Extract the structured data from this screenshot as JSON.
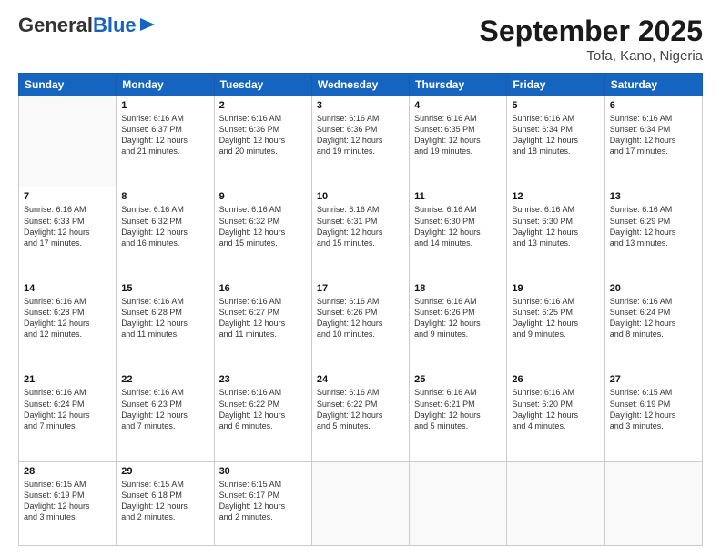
{
  "header": {
    "logo": {
      "general": "General",
      "blue": "Blue"
    },
    "title": "September 2025",
    "location": "Tofa, Kano, Nigeria"
  },
  "days_of_week": [
    "Sunday",
    "Monday",
    "Tuesday",
    "Wednesday",
    "Thursday",
    "Friday",
    "Saturday"
  ],
  "weeks": [
    [
      {
        "day": "",
        "info": ""
      },
      {
        "day": "1",
        "info": "Sunrise: 6:16 AM\nSunset: 6:37 PM\nDaylight: 12 hours\nand 21 minutes."
      },
      {
        "day": "2",
        "info": "Sunrise: 6:16 AM\nSunset: 6:36 PM\nDaylight: 12 hours\nand 20 minutes."
      },
      {
        "day": "3",
        "info": "Sunrise: 6:16 AM\nSunset: 6:36 PM\nDaylight: 12 hours\nand 19 minutes."
      },
      {
        "day": "4",
        "info": "Sunrise: 6:16 AM\nSunset: 6:35 PM\nDaylight: 12 hours\nand 19 minutes."
      },
      {
        "day": "5",
        "info": "Sunrise: 6:16 AM\nSunset: 6:34 PM\nDaylight: 12 hours\nand 18 minutes."
      },
      {
        "day": "6",
        "info": "Sunrise: 6:16 AM\nSunset: 6:34 PM\nDaylight: 12 hours\nand 17 minutes."
      }
    ],
    [
      {
        "day": "7",
        "info": "Sunrise: 6:16 AM\nSunset: 6:33 PM\nDaylight: 12 hours\nand 17 minutes."
      },
      {
        "day": "8",
        "info": "Sunrise: 6:16 AM\nSunset: 6:32 PM\nDaylight: 12 hours\nand 16 minutes."
      },
      {
        "day": "9",
        "info": "Sunrise: 6:16 AM\nSunset: 6:32 PM\nDaylight: 12 hours\nand 15 minutes."
      },
      {
        "day": "10",
        "info": "Sunrise: 6:16 AM\nSunset: 6:31 PM\nDaylight: 12 hours\nand 15 minutes."
      },
      {
        "day": "11",
        "info": "Sunrise: 6:16 AM\nSunset: 6:30 PM\nDaylight: 12 hours\nand 14 minutes."
      },
      {
        "day": "12",
        "info": "Sunrise: 6:16 AM\nSunset: 6:30 PM\nDaylight: 12 hours\nand 13 minutes."
      },
      {
        "day": "13",
        "info": "Sunrise: 6:16 AM\nSunset: 6:29 PM\nDaylight: 12 hours\nand 13 minutes."
      }
    ],
    [
      {
        "day": "14",
        "info": "Sunrise: 6:16 AM\nSunset: 6:28 PM\nDaylight: 12 hours\nand 12 minutes."
      },
      {
        "day": "15",
        "info": "Sunrise: 6:16 AM\nSunset: 6:28 PM\nDaylight: 12 hours\nand 11 minutes."
      },
      {
        "day": "16",
        "info": "Sunrise: 6:16 AM\nSunset: 6:27 PM\nDaylight: 12 hours\nand 11 minutes."
      },
      {
        "day": "17",
        "info": "Sunrise: 6:16 AM\nSunset: 6:26 PM\nDaylight: 12 hours\nand 10 minutes."
      },
      {
        "day": "18",
        "info": "Sunrise: 6:16 AM\nSunset: 6:26 PM\nDaylight: 12 hours\nand 9 minutes."
      },
      {
        "day": "19",
        "info": "Sunrise: 6:16 AM\nSunset: 6:25 PM\nDaylight: 12 hours\nand 9 minutes."
      },
      {
        "day": "20",
        "info": "Sunrise: 6:16 AM\nSunset: 6:24 PM\nDaylight: 12 hours\nand 8 minutes."
      }
    ],
    [
      {
        "day": "21",
        "info": "Sunrise: 6:16 AM\nSunset: 6:24 PM\nDaylight: 12 hours\nand 7 minutes."
      },
      {
        "day": "22",
        "info": "Sunrise: 6:16 AM\nSunset: 6:23 PM\nDaylight: 12 hours\nand 7 minutes."
      },
      {
        "day": "23",
        "info": "Sunrise: 6:16 AM\nSunset: 6:22 PM\nDaylight: 12 hours\nand 6 minutes."
      },
      {
        "day": "24",
        "info": "Sunrise: 6:16 AM\nSunset: 6:22 PM\nDaylight: 12 hours\nand 5 minutes."
      },
      {
        "day": "25",
        "info": "Sunrise: 6:16 AM\nSunset: 6:21 PM\nDaylight: 12 hours\nand 5 minutes."
      },
      {
        "day": "26",
        "info": "Sunrise: 6:16 AM\nSunset: 6:20 PM\nDaylight: 12 hours\nand 4 minutes."
      },
      {
        "day": "27",
        "info": "Sunrise: 6:15 AM\nSunset: 6:19 PM\nDaylight: 12 hours\nand 3 minutes."
      }
    ],
    [
      {
        "day": "28",
        "info": "Sunrise: 6:15 AM\nSunset: 6:19 PM\nDaylight: 12 hours\nand 3 minutes."
      },
      {
        "day": "29",
        "info": "Sunrise: 6:15 AM\nSunset: 6:18 PM\nDaylight: 12 hours\nand 2 minutes."
      },
      {
        "day": "30",
        "info": "Sunrise: 6:15 AM\nSunset: 6:17 PM\nDaylight: 12 hours\nand 2 minutes."
      },
      {
        "day": "",
        "info": ""
      },
      {
        "day": "",
        "info": ""
      },
      {
        "day": "",
        "info": ""
      },
      {
        "day": "",
        "info": ""
      }
    ]
  ]
}
